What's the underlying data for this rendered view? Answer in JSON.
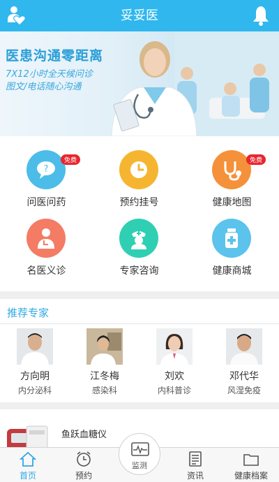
{
  "header": {
    "title": "妥妥医"
  },
  "banner": {
    "headline": "医患沟通零距离",
    "line2": "7X12小时全天候问诊",
    "line3": "图文/电话随心沟通"
  },
  "services": [
    {
      "label": "问医问药",
      "badge": "免费",
      "color": "#4bbde8",
      "icon": "chat-question-icon"
    },
    {
      "label": "预约挂号",
      "badge": "",
      "color": "#f6b530",
      "icon": "clock-icon"
    },
    {
      "label": "健康地图",
      "badge": "免费",
      "color": "#f4913a",
      "icon": "stethoscope-icon"
    },
    {
      "label": "名医义诊",
      "badge": "",
      "color": "#f47c64",
      "icon": "doctor-icon"
    },
    {
      "label": "专家咨询",
      "badge": "",
      "color": "#2fcfb4",
      "icon": "nurse-icon"
    },
    {
      "label": "健康商城",
      "badge": "",
      "color": "#5bc3ec",
      "icon": "medicine-bottle-icon"
    }
  ],
  "experts": {
    "title": "推荐专家",
    "doctors": [
      {
        "name": "方向明",
        "dept": "内分泌科"
      },
      {
        "name": "江冬梅",
        "dept": "感染科"
      },
      {
        "name": "刘欢",
        "dept": "内科普诊"
      },
      {
        "name": "邓代华",
        "dept": "风湿免疫"
      }
    ]
  },
  "product": {
    "name": "鱼跃血糖仪"
  },
  "tabbar": {
    "items": [
      {
        "label": "首页",
        "icon": "home-icon"
      },
      {
        "label": "预约",
        "icon": "alarm-clock-icon"
      },
      {
        "label": "资讯",
        "icon": "news-icon"
      },
      {
        "label": "健康档案",
        "icon": "folder-icon"
      }
    ],
    "center_label": "监测",
    "active_color": "#2fa9e4"
  },
  "colors": {
    "brand": "#2fb7ee",
    "badge": "#e8262e"
  }
}
